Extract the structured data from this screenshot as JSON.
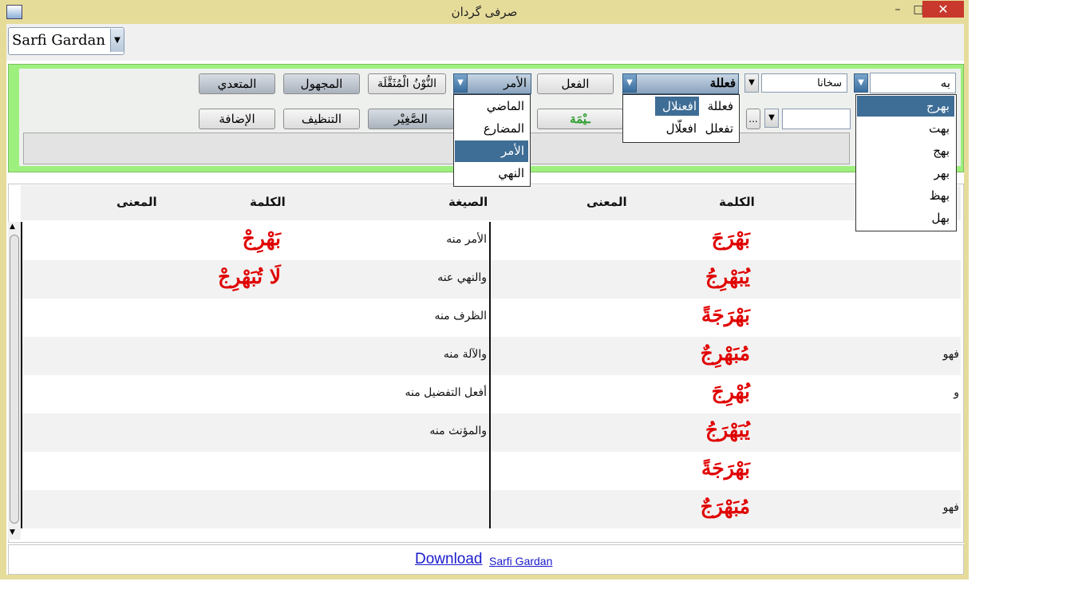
{
  "window": {
    "title": "صرفی گردان",
    "minimize_glyph": "–",
    "maximize_glyph": "□",
    "close_glyph": "✕"
  },
  "top_combo": {
    "value": "Sarfi Gardan"
  },
  "controls": {
    "root_input": "به",
    "sahaba_field": "سخانا",
    "bab_combo": "فعللة",
    "fil_button": "الفعل",
    "amr_combo": "الأمر",
    "nun_button": "النُّوْنُ الْمُثَقَّلَة",
    "majhul_button": "المجهول",
    "mutaddi_button": "المتعدي",
    "ellipsis_button": "...",
    "saghir_button": "الصَّغِيْر",
    "green_button_text": "ـيْمَة",
    "tanzif_button": "التنظيف",
    "idafa_button": "الإضافة"
  },
  "dropdowns": {
    "roots": [
      "بهرج",
      "بهت",
      "بهج",
      "بهر",
      "بهظ",
      "بهل"
    ],
    "roots_selected": 0,
    "babs": [
      [
        "فعللة",
        "افعنلال"
      ],
      [
        "تفعلل",
        "افعلّال"
      ]
    ],
    "tenses": [
      "الماضي",
      "المضارع",
      "الأمر",
      "النهي"
    ],
    "tenses_selected": 2
  },
  "table": {
    "headers": {
      "kalima_right": "الكلمة",
      "mana_right": "المعنى",
      "sigha": "الصيغة",
      "kalima_left": "الكلمة",
      "mana_left": "المعنى"
    },
    "right_rows": [
      {
        "prefix": "",
        "word": "بَهْرَجَ"
      },
      {
        "prefix": "",
        "word": "يُبَهْرِجُ"
      },
      {
        "prefix": "",
        "word": "بَهْرَجَةً"
      },
      {
        "prefix": "فهو",
        "word": "مُبَهْرِجٌ"
      },
      {
        "prefix": "و",
        "word": "بُهْرِجَ"
      },
      {
        "prefix": "",
        "word": "يُبَهْرَجُ"
      },
      {
        "prefix": "",
        "word": "بَهْرَجَةً"
      },
      {
        "prefix": "فهو",
        "word": "مُبَهْرَجٌ"
      }
    ],
    "left_rows": [
      {
        "sigha": "الأمر منه",
        "word": "بَهْرِجْ"
      },
      {
        "sigha": "والنهي عنه",
        "word": "لَا تُبَهْرِجْ"
      },
      {
        "sigha": "الظرف منه",
        "word": ""
      },
      {
        "sigha": "والآلة منه",
        "word": ""
      },
      {
        "sigha": "أفعل التفضيل منه",
        "word": ""
      },
      {
        "sigha": "والمؤنث منه",
        "word": ""
      },
      {
        "sigha": "",
        "word": ""
      },
      {
        "sigha": "",
        "word": ""
      }
    ]
  },
  "footer": {
    "download": "Download",
    "link": "Sarfi Gardan"
  }
}
